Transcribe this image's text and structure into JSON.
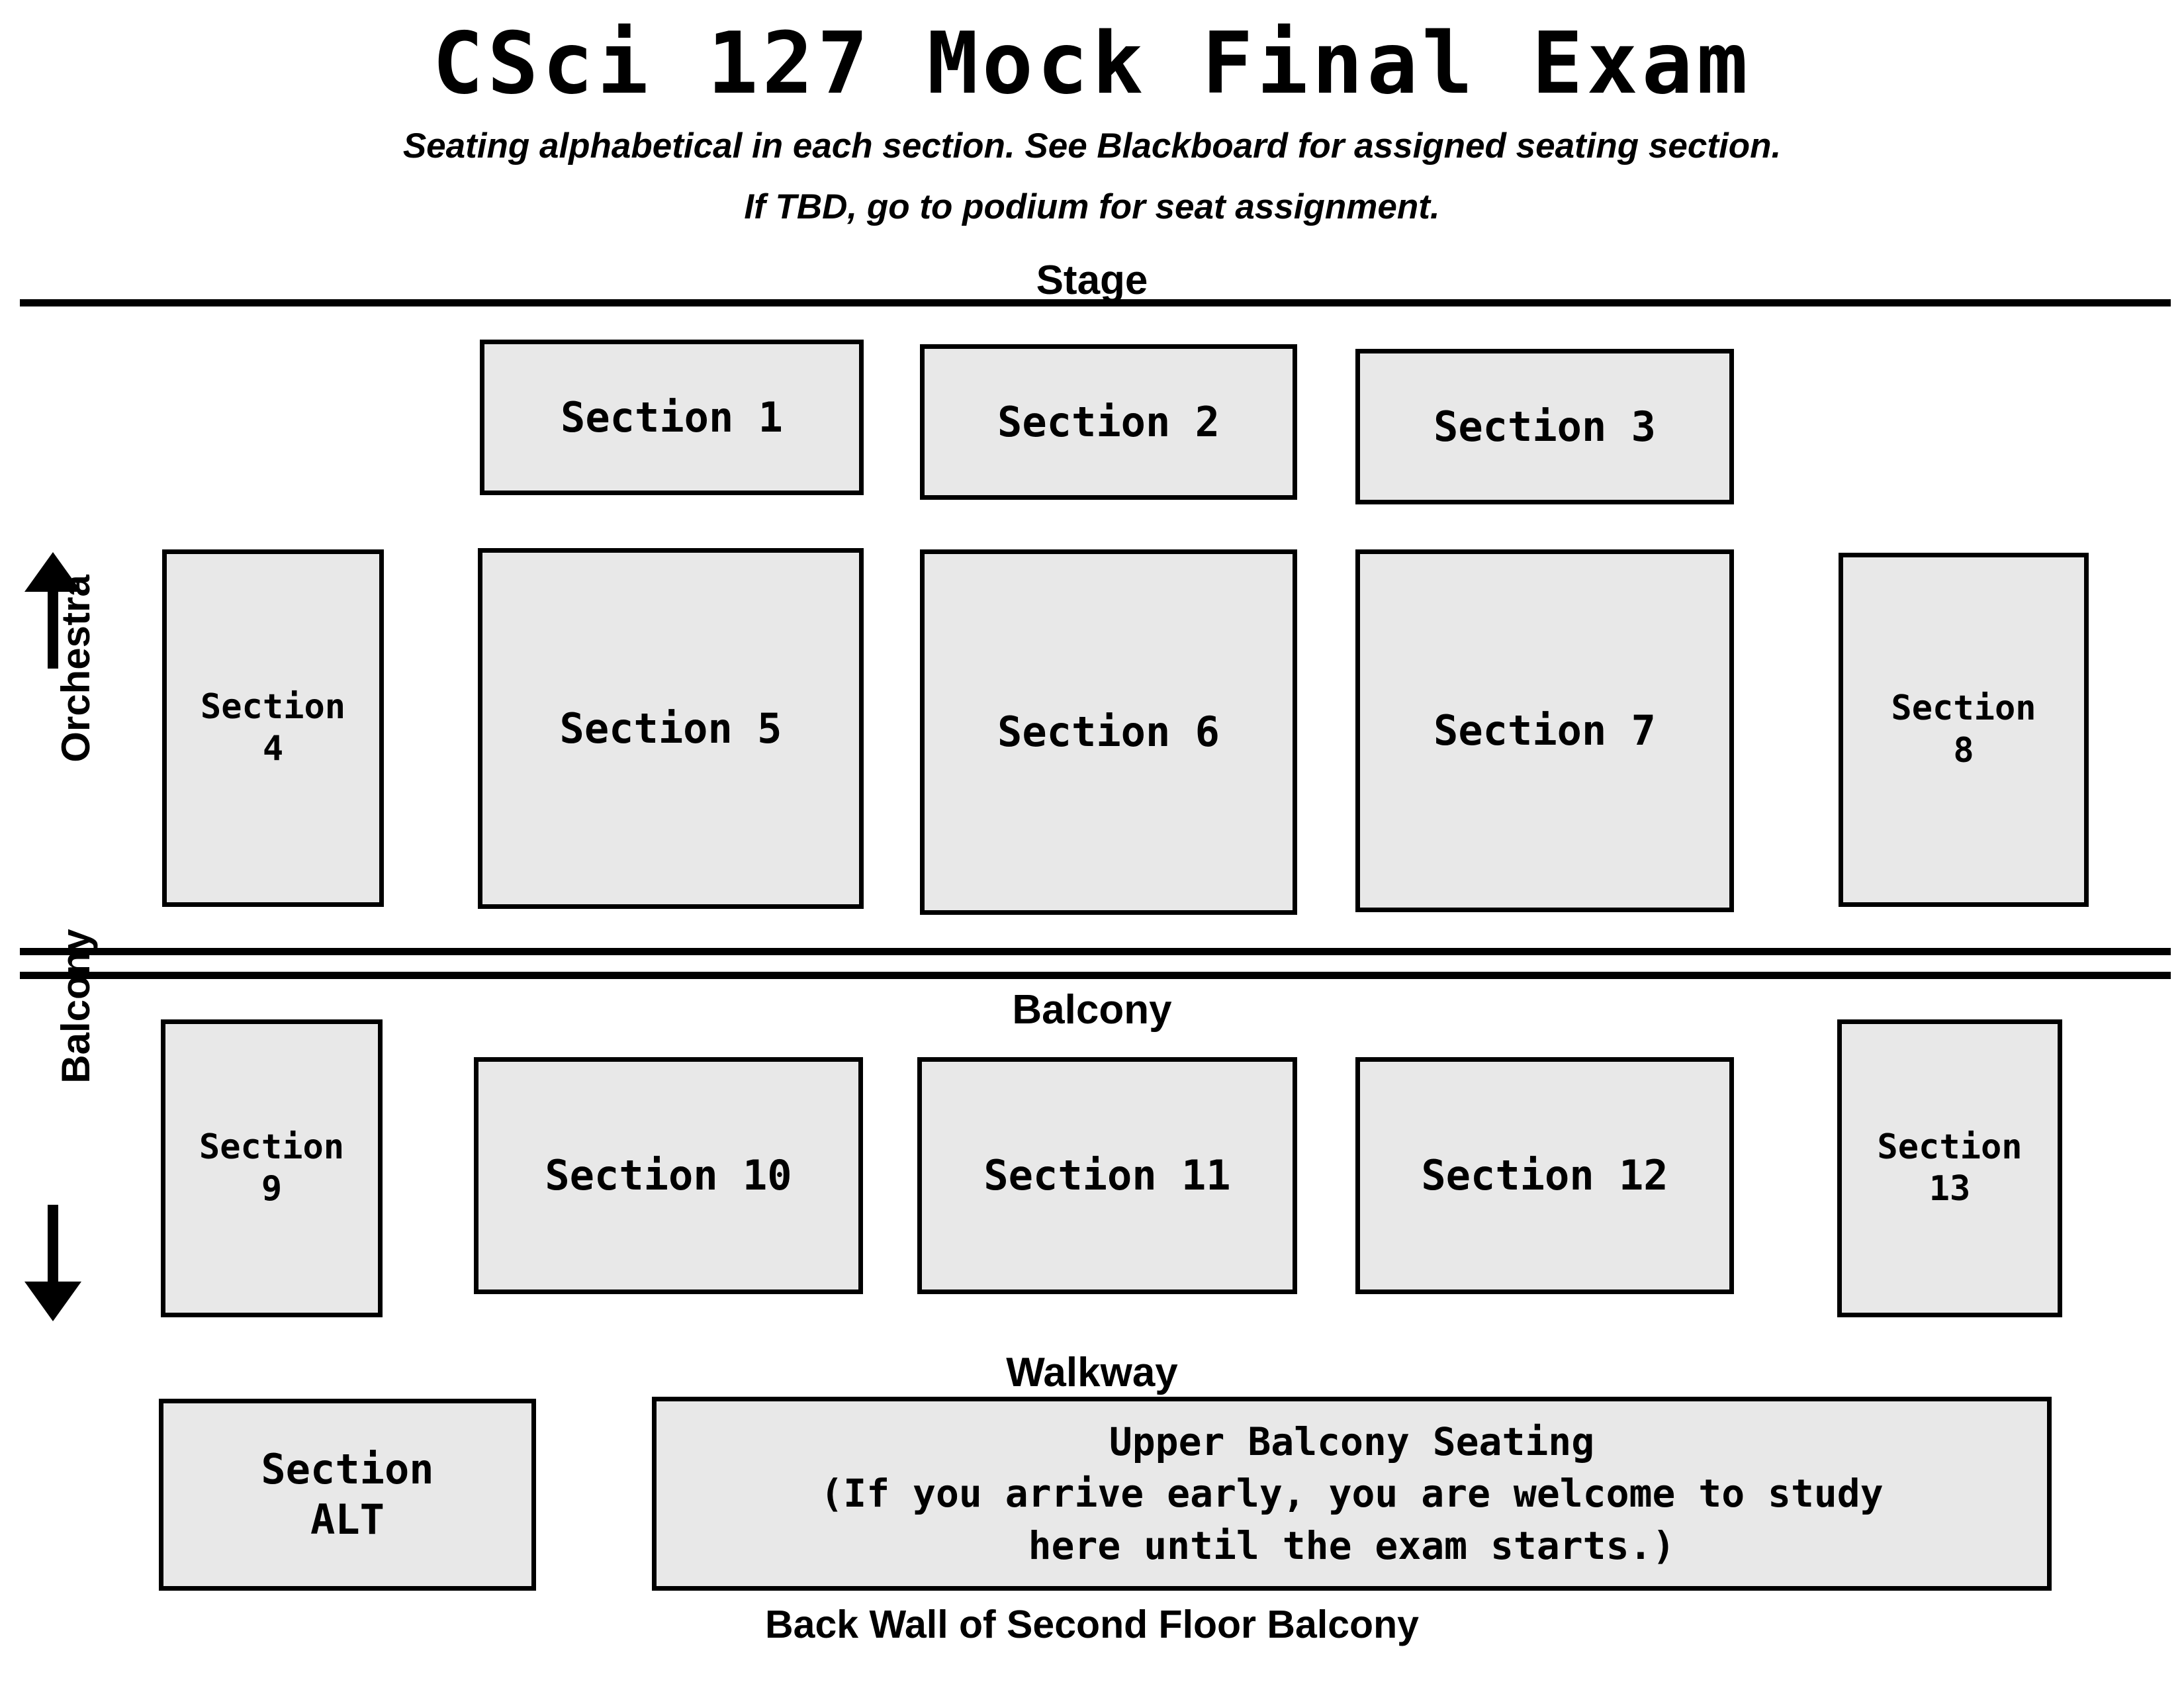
{
  "header": {
    "title": "CSci 127 Mock Final Exam",
    "subtitle_line1": "Seating alphabetical in each section.  See Blackboard for assigned seating section.",
    "subtitle_line2": "If TBD, go to podium for seat assignment."
  },
  "area_labels": {
    "stage": "Stage",
    "balcony": "Balcony",
    "walkway": "Walkway",
    "back_wall": "Back Wall of Second Floor Balcony"
  },
  "side_labels": {
    "orchestra": "Orchestra",
    "balcony": "Balcony"
  },
  "sections": {
    "front_row": [
      {
        "id": "section-1",
        "label": "Section 1"
      },
      {
        "id": "section-2",
        "label": "Section 2"
      },
      {
        "id": "section-3",
        "label": "Section 3"
      }
    ],
    "orchestra_row": [
      {
        "id": "section-4",
        "label": "Section\n4"
      },
      {
        "id": "section-5",
        "label": "Section 5"
      },
      {
        "id": "section-6",
        "label": "Section 6"
      },
      {
        "id": "section-7",
        "label": "Section 7"
      },
      {
        "id": "section-8",
        "label": "Section\n8"
      }
    ],
    "balcony_row": [
      {
        "id": "section-9",
        "label": "Section\n9"
      },
      {
        "id": "section-10",
        "label": "Section 10"
      },
      {
        "id": "section-11",
        "label": "Section 11"
      },
      {
        "id": "section-12",
        "label": "Section 12"
      },
      {
        "id": "section-13",
        "label": "Section\n13"
      }
    ],
    "back_row": [
      {
        "id": "section-alt",
        "label": "Section\nALT"
      },
      {
        "id": "upper-balcony",
        "label": "Upper Balcony Seating\n(If you arrive early, you are welcome to study\nhere until the exam starts.)"
      }
    ]
  },
  "colors": {
    "box_fill": "#e8e8e8",
    "box_border": "#000000",
    "text": "#000000",
    "background": "#ffffff"
  }
}
